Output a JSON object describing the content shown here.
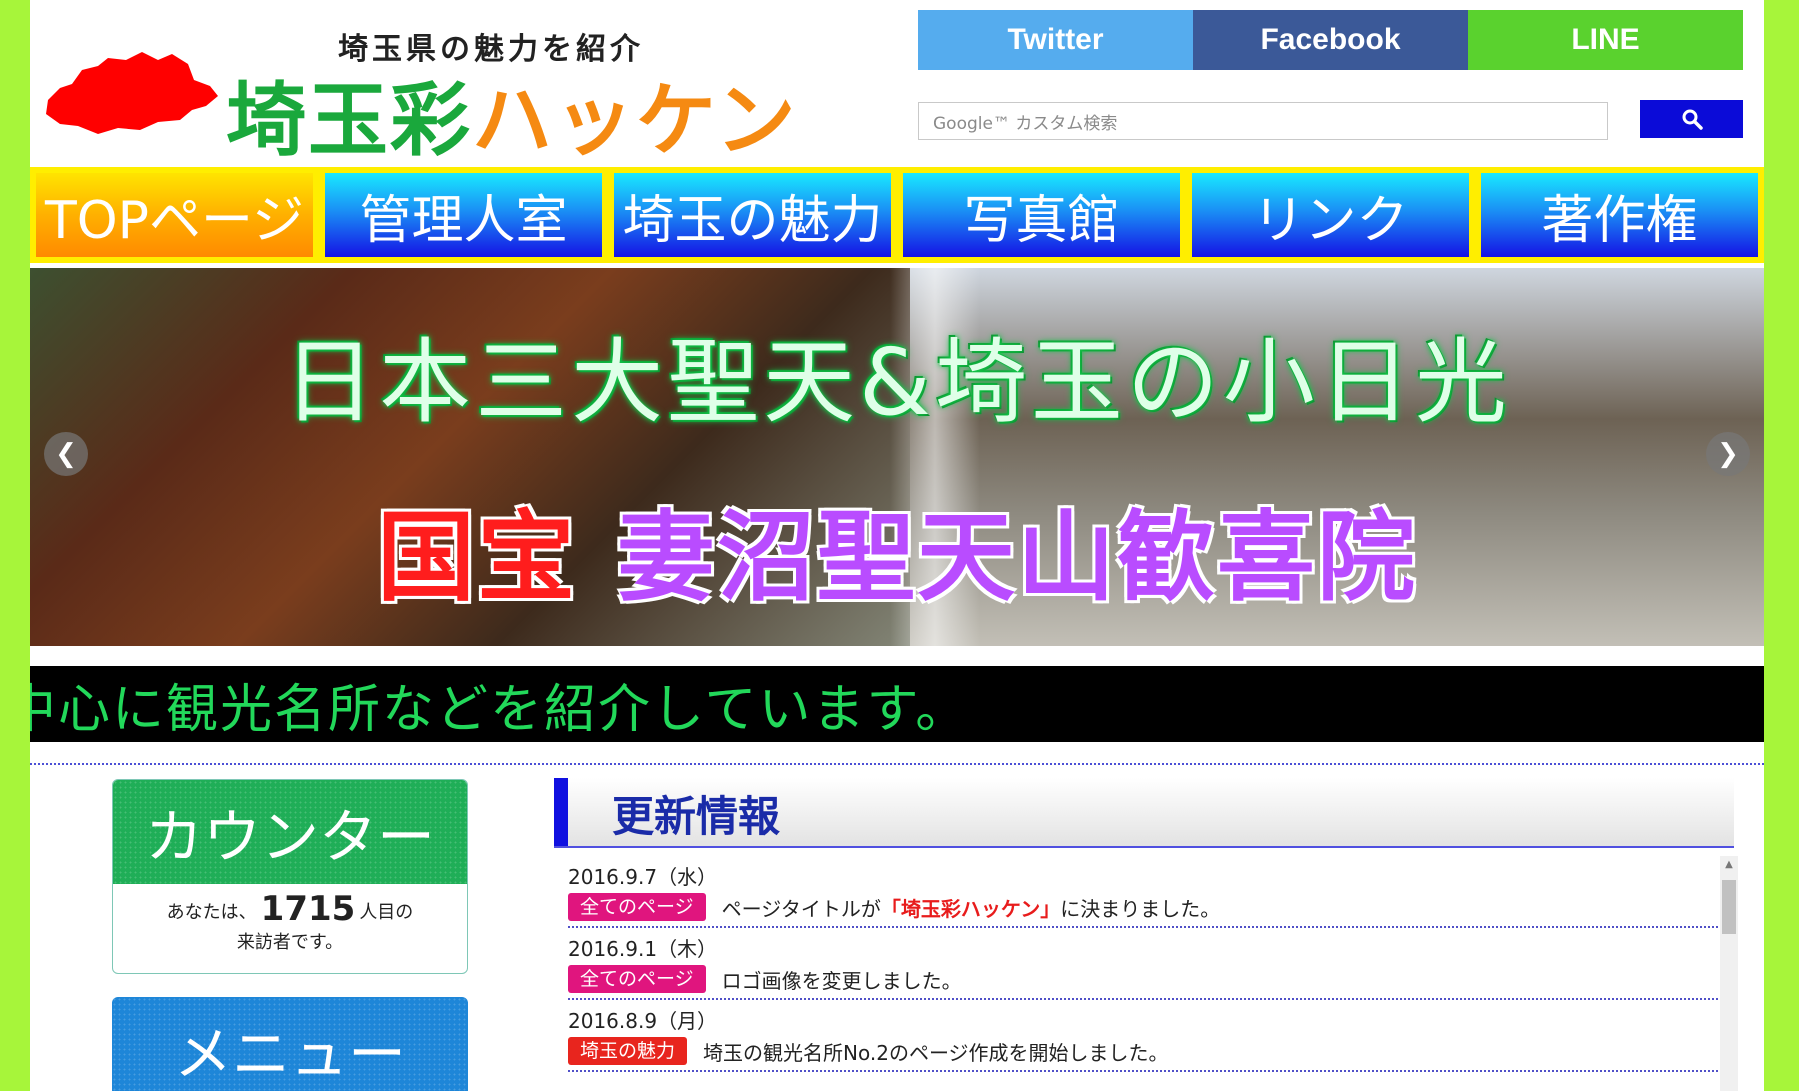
{
  "header": {
    "tagline": "埼玉県の魅力を紹介",
    "logo_title_green": "埼玉彩",
    "logo_title_orange": "ハッケン"
  },
  "social": {
    "twitter": "Twitter",
    "facebook": "Facebook",
    "line": "LINE"
  },
  "search": {
    "placeholder": "Google™ カスタム検索",
    "button_icon": "search-icon"
  },
  "nav": {
    "items": [
      {
        "label": "TOPページ",
        "active": true
      },
      {
        "label": "管理人室"
      },
      {
        "label": "埼玉の魅力"
      },
      {
        "label": "写真館"
      },
      {
        "label": "リンク"
      },
      {
        "label": "著作権"
      }
    ]
  },
  "hero": {
    "line1": "日本三大聖天&埼玉の小日光",
    "line2_red": "国宝",
    "line2_purple": "妻沼聖天山歓喜院",
    "prev_icon": "chevron-left-icon",
    "next_icon": "chevron-right-icon"
  },
  "marquee": {
    "text": "中心に観光名所などを紹介しています。"
  },
  "counter": {
    "title": "カウンター",
    "prefix": "あなたは、",
    "count": "1715",
    "suffix": "人目の",
    "line2": "来訪者です。"
  },
  "menu": {
    "title": "メニュー"
  },
  "updates": {
    "title": "更新情報",
    "entries": [
      {
        "date": "2016.9.7（水）",
        "tag": "全てのページ",
        "tag_color": "#e0157e",
        "text_before": "ページタイトルが",
        "text_highlight": "「埼玉彩ハッケン」",
        "text_after": "に決まりました。"
      },
      {
        "date": "2016.9.1（木）",
        "tag": "全てのページ",
        "tag_color": "#e0157e",
        "text_before": "ロゴ画像を変更しました。",
        "text_highlight": "",
        "text_after": ""
      },
      {
        "date": "2016.8.9（月）",
        "tag": "埼玉の魅力",
        "tag_color": "#e8251e",
        "text_before": "埼玉の観光名所No.2のページ作成を開始しました。",
        "text_highlight": "",
        "text_after": ""
      }
    ]
  }
}
